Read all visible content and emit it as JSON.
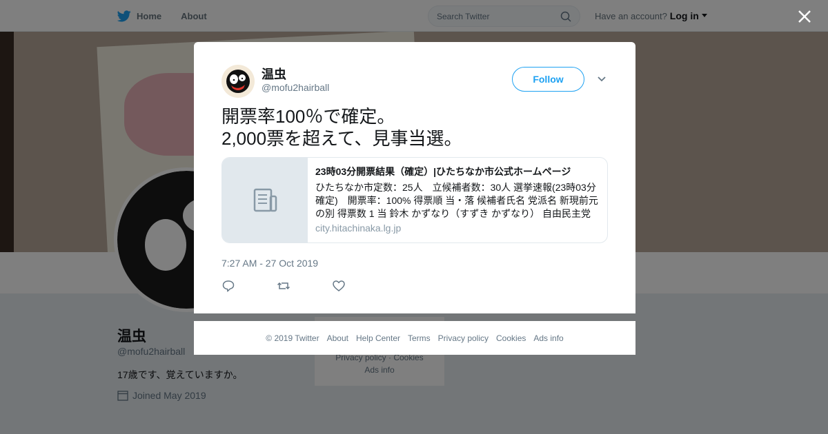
{
  "nav": {
    "home_label": "Home",
    "about_label": "About",
    "search_placeholder": "Search Twitter",
    "account_prompt": "Have an account?",
    "login_label": "Log in"
  },
  "profile": {
    "name": "温虫",
    "handle": "@mofu2hairball",
    "bio": "17歳です、覚えていますか。",
    "joined": "Joined May 2019",
    "sidebar_footer": [
      "Privacy policy",
      "Cookies",
      "Ads info"
    ]
  },
  "tweet": {
    "author_name": "温虫",
    "author_handle": "@mofu2hairball",
    "follow_label": "Follow",
    "text_line1": "開票率100％で確定。",
    "text_line2": "2,000票を超えて、見事当選。",
    "card": {
      "title": "23時03分開票結果（確定）|ひたちなか市公式ホームページ",
      "description": "ひたちなか市定数：25人　立候補者数：30人 選挙速報(23時03分確定)　開票率：100% 得票順 当・落 候補者氏名 党派名 新現前元の別 得票数 1 当 鈴木 かずなり（すずき かずなり） 自由民主党",
      "domain": "city.hitachinaka.lg.jp"
    },
    "timestamp": "7:27 AM - 27 Oct 2019",
    "actions": [
      "reply-icon",
      "retweet-icon",
      "like-icon"
    ]
  },
  "footer": {
    "links": [
      "© 2019 Twitter",
      "About",
      "Help Center",
      "Terms",
      "Privacy policy",
      "Cookies",
      "Ads info"
    ]
  },
  "colors": {
    "brand": "#1da1f2",
    "overlay": "rgba(0,0,0,0.5)",
    "secondary_text": "#657786"
  }
}
